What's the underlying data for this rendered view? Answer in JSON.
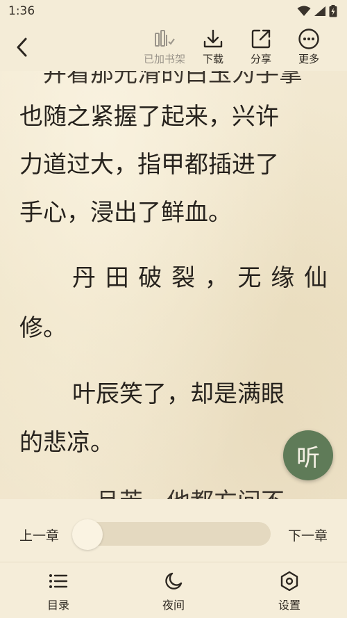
{
  "status_bar": {
    "time": "1:36"
  },
  "toolbar": {
    "added_to_shelf": "已加书架",
    "download": "下载",
    "share": "分享",
    "more": "更多"
  },
  "content": {
    "lines": [
      "也随之紧握了起来，兴许",
      "力道过大，指甲都插进了",
      "手心，浸出了鲜血。",
      "修。",
      "的悲凉。"
    ],
    "justified_lines": [
      [
        "丹",
        "田",
        "破",
        "裂",
        "，",
        "无",
        "缘",
        "仙"
      ],
      [
        "叶辰笑了，却是满眼"
      ]
    ]
  },
  "listen_button": {
    "label": "听"
  },
  "chapter_nav": {
    "prev": "上一章",
    "next": "下一章",
    "progress": 0.0
  },
  "bottom_nav": {
    "catalog": "目录",
    "night": "夜间",
    "settings": "设置"
  },
  "colors": {
    "paper": "#f1e7cf",
    "text": "#26221d",
    "listen_fab": "#5f7b58",
    "slider_track": "#e4d9c0"
  }
}
